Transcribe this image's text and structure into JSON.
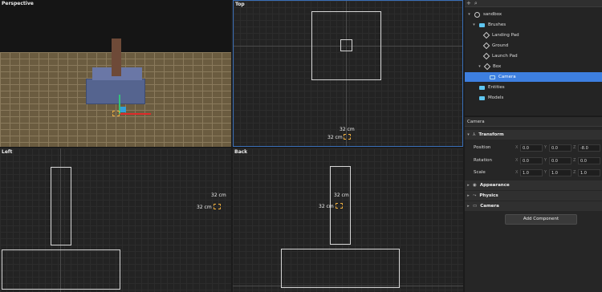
{
  "viewports": {
    "perspective": {
      "title": "Perspective"
    },
    "top": {
      "title": "Top",
      "dim_top": "32 cm",
      "dim_side": "32 cm"
    },
    "left": {
      "title": "Left",
      "dim_top": "32 cm",
      "dim_side": "32 cm"
    },
    "back": {
      "title": "Back",
      "dim_top": "32 cm",
      "dim_side": "32 cm"
    }
  },
  "panel": {
    "toolbar": {
      "add_icon": "+",
      "search_icon": "⌕"
    },
    "tree": [
      {
        "label": "sandbox",
        "icon": "scene-icon",
        "expanded": true
      },
      {
        "label": "Brushes",
        "icon": "folder-icon",
        "expanded": true
      },
      {
        "label": "Landing Pad",
        "icon": "cube-icon"
      },
      {
        "label": "Ground",
        "icon": "cube-icon"
      },
      {
        "label": "Launch Pad",
        "icon": "cube-icon"
      },
      {
        "label": "Box",
        "icon": "cube-icon",
        "expanded": true
      },
      {
        "label": "Camera",
        "icon": "camera-icon",
        "selected": true
      },
      {
        "label": "Entities",
        "icon": "folder-icon"
      },
      {
        "label": "Models",
        "icon": "folder-icon"
      }
    ],
    "selected_name": "Camera",
    "transform": {
      "title": "Transform",
      "position": {
        "label": "Position",
        "x": "0.0",
        "y": "0.0",
        "z": "-8.0"
      },
      "rotation": {
        "label": "Rotation",
        "x": "0.0",
        "y": "0.0",
        "z": "0.0"
      },
      "scale": {
        "label": "Scale",
        "x": "1.0",
        "y": "1.0",
        "z": "1.0"
      }
    },
    "axes": {
      "x": "X",
      "y": "Y",
      "z": "Z"
    },
    "sections": {
      "appearance": "Appearance",
      "physics": "Physics",
      "camera": "Camera"
    },
    "add_component": "Add Component"
  },
  "colors": {
    "selection": "#3d7fe0",
    "viewport_active_border": "#3a6fb8",
    "camera_gizmo": "#f0b040"
  }
}
